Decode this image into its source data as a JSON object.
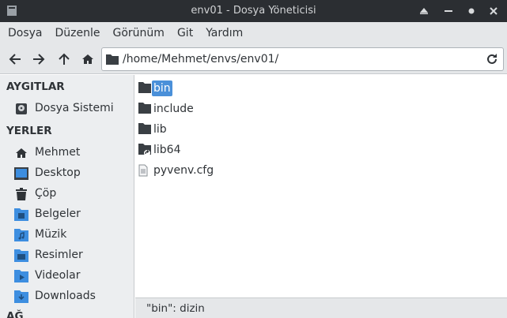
{
  "window": {
    "title": "env01 - Dosya Yöneticisi"
  },
  "menu": [
    "Dosya",
    "Düzenle",
    "Görünüm",
    "Git",
    "Yardım"
  ],
  "location": {
    "path": "/home/Mehmet/envs/env01/"
  },
  "sidebar": {
    "devices_heading": "AYGITLAR",
    "devices": [
      {
        "label": "Dosya Sistemi",
        "icon": "drive-icon"
      }
    ],
    "places_heading": "YERLER",
    "places": [
      {
        "label": "Mehmet",
        "icon": "home-icon"
      },
      {
        "label": "Desktop",
        "icon": "desktop-icon"
      },
      {
        "label": "Çöp",
        "icon": "trash-icon"
      },
      {
        "label": "Belgeler",
        "icon": "documents-folder-icon"
      },
      {
        "label": "Müzik",
        "icon": "music-folder-icon"
      },
      {
        "label": "Resimler",
        "icon": "pictures-folder-icon"
      },
      {
        "label": "Videolar",
        "icon": "videos-folder-icon"
      },
      {
        "label": "Downloads",
        "icon": "downloads-folder-icon"
      }
    ],
    "network_heading_partial": "AĞ"
  },
  "files": [
    {
      "name": "bin",
      "type": "folder",
      "selected": true
    },
    {
      "name": "include",
      "type": "folder"
    },
    {
      "name": "lib",
      "type": "folder"
    },
    {
      "name": "lib64",
      "type": "folder-link"
    },
    {
      "name": "pyvenv.cfg",
      "type": "text-file"
    }
  ],
  "status": {
    "text": "\"bin\": dizin"
  },
  "colors": {
    "selection": "#4a90d9",
    "titlebar": "#2b2e32",
    "folder_blue": "#3d8ee0",
    "folder_dark": "#3a3f44"
  }
}
